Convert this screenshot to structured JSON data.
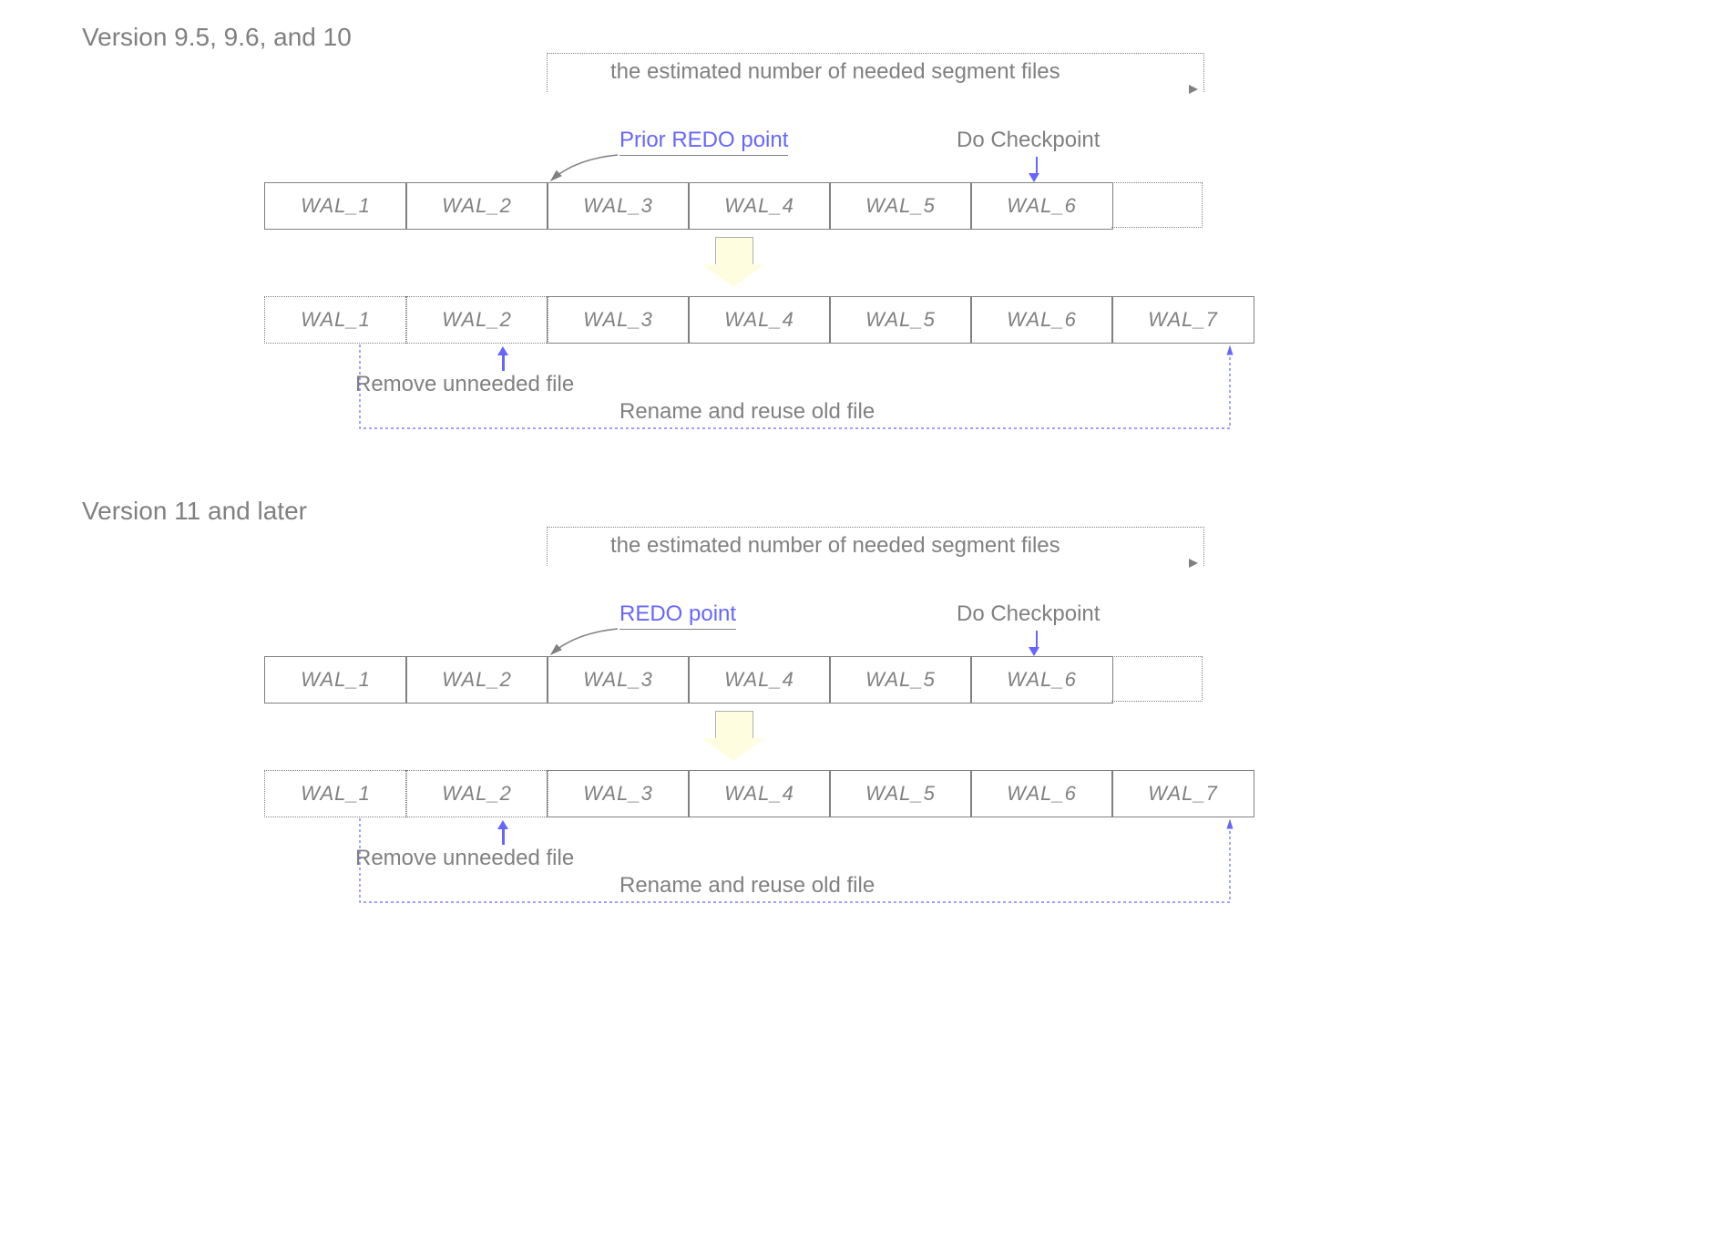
{
  "section1": {
    "title": "Version 9.5, 9.6, and 10",
    "est_label": "the estimated number of needed segment files",
    "redo_label": "Prior REDO point",
    "checkpoint_label": "Do Checkpoint",
    "top_segments": [
      "WAL_1",
      "WAL_2",
      "WAL_3",
      "WAL_4",
      "WAL_5",
      "WAL_6"
    ],
    "bottom_segments": [
      "WAL_1",
      "WAL_2",
      "WAL_3",
      "WAL_4",
      "WAL_5",
      "WAL_6",
      "WAL_7"
    ],
    "remove_label": "Remove unneeded file",
    "reuse_label": "Rename and reuse old file"
  },
  "section2": {
    "title": "Version 11 and later",
    "est_label": "the estimated number of needed segment files",
    "redo_label": "REDO point",
    "checkpoint_label": "Do Checkpoint",
    "top_segments": [
      "WAL_1",
      "WAL_2",
      "WAL_3",
      "WAL_4",
      "WAL_5",
      "WAL_6"
    ],
    "bottom_segments": [
      "WAL_1",
      "WAL_2",
      "WAL_3",
      "WAL_4",
      "WAL_5",
      "WAL_6",
      "WAL_7"
    ],
    "remove_label": "Remove unneeded file",
    "reuse_label": "Rename and reuse old file"
  }
}
